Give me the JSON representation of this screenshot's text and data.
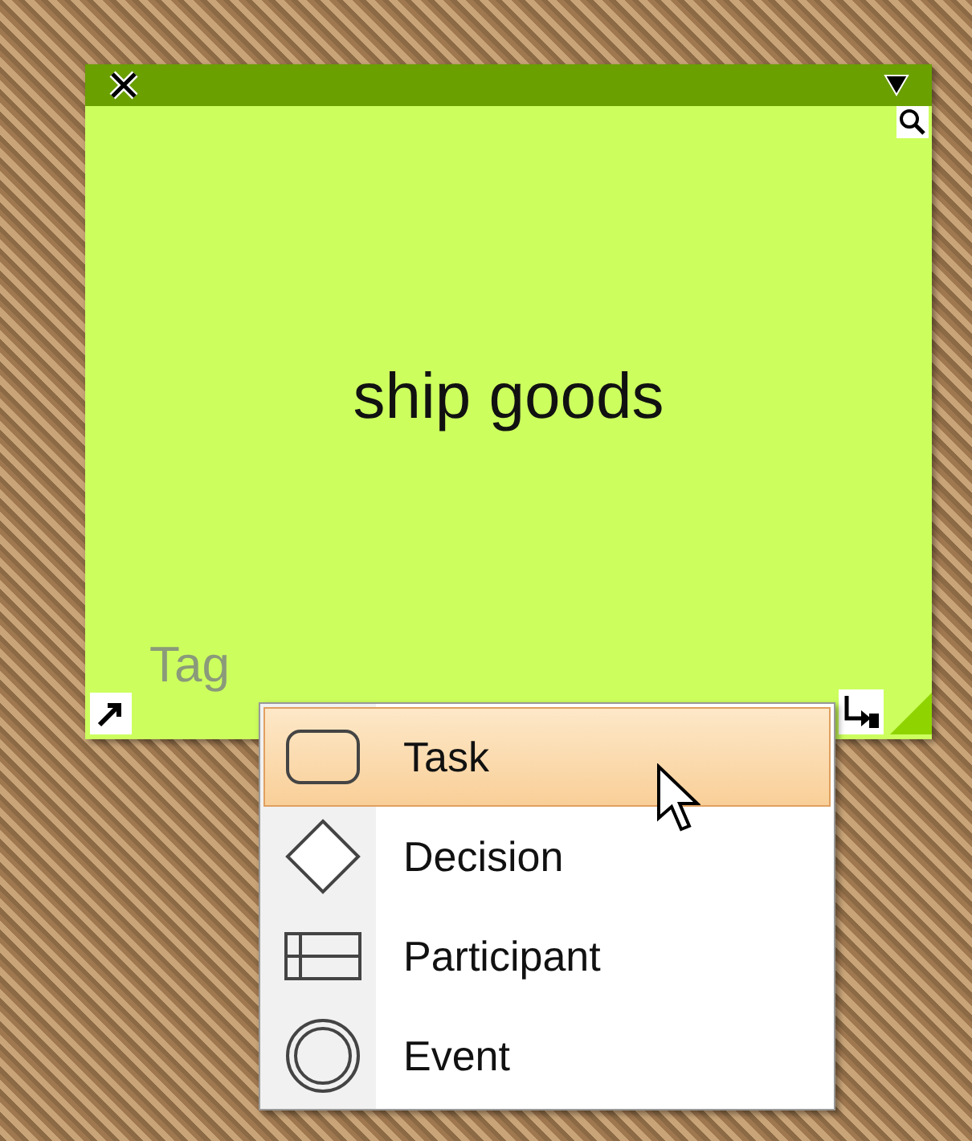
{
  "note": {
    "title": "ship goods",
    "tag": "Tag"
  },
  "menu": {
    "items": [
      {
        "label": "Task",
        "kind": "task",
        "selected": true
      },
      {
        "label": "Decision",
        "kind": "decision",
        "selected": false
      },
      {
        "label": "Participant",
        "kind": "participant",
        "selected": false
      },
      {
        "label": "Event",
        "kind": "event",
        "selected": false
      }
    ]
  }
}
